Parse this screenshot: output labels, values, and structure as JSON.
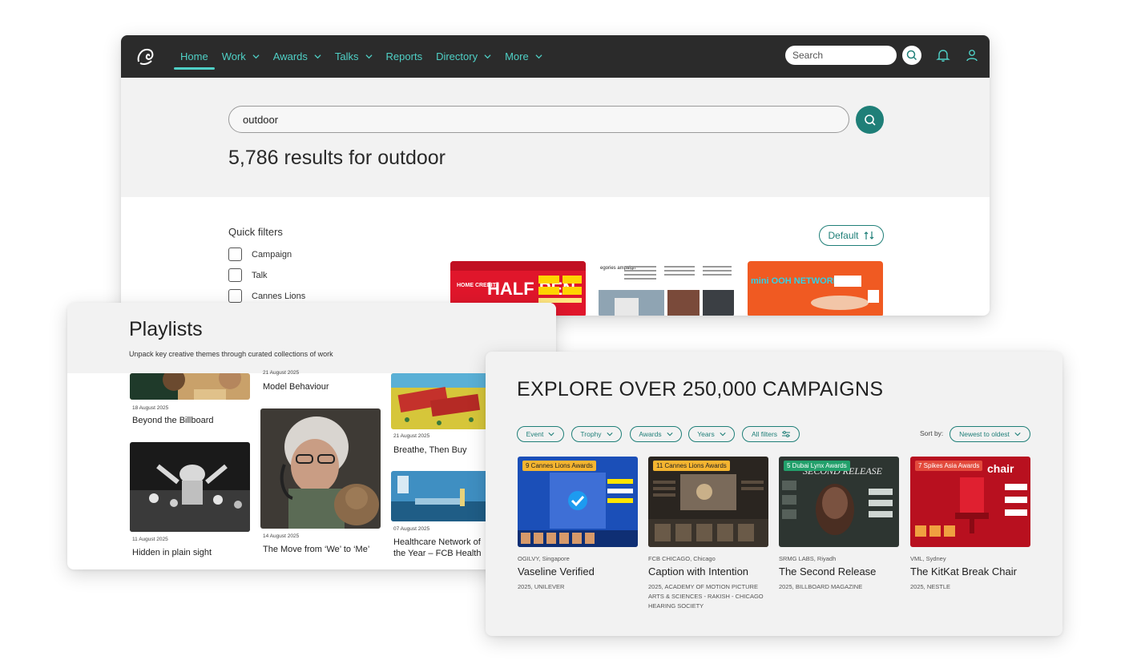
{
  "colors": {
    "accent": "#4fd0c6",
    "brand_teal": "#1f7f78",
    "nav_bg": "#2b2b2b",
    "badge": "#f5b530"
  },
  "nav": {
    "items": [
      {
        "label": "Home",
        "active": true,
        "has_dropdown": false
      },
      {
        "label": "Work",
        "has_dropdown": true
      },
      {
        "label": "Awards",
        "has_dropdown": true
      },
      {
        "label": "Talks",
        "has_dropdown": true
      },
      {
        "label": "Reports",
        "has_dropdown": false
      },
      {
        "label": "Directory",
        "has_dropdown": true
      },
      {
        "label": "More",
        "has_dropdown": true
      }
    ],
    "search_placeholder": "Search",
    "icons": [
      "lion-logo-icon",
      "search-icon",
      "bell-icon",
      "user-icon"
    ]
  },
  "search": {
    "query": "outdoor",
    "results_title": "5,786 results for outdoor",
    "sort_label": "Default"
  },
  "quick_filters": {
    "title": "Quick filters",
    "options": [
      "Campaign",
      "Talk",
      "Cannes Lions"
    ]
  },
  "playlists": {
    "title": "Playlists",
    "subtitle": "Unpack key creative themes through curated collections of work",
    "items": [
      {
        "date": "18 August 2025",
        "name": "Beyond the Billboard"
      },
      {
        "date": "21 August 2025",
        "name": "Model Behaviour"
      },
      {
        "date": "21 August 2025",
        "name": "Breathe, Then Buy"
      },
      {
        "date": "11 August 2025",
        "name": "Hidden in plain sight"
      },
      {
        "date": "14 August 2025",
        "name": "The Move from ‘We’ to ‘Me’"
      },
      {
        "date": "07 August 2025",
        "name": "Healthcare Network of the Year – FCB Health"
      }
    ]
  },
  "explore": {
    "title": "EXPLORE OVER 250,000 CAMPAIGNS",
    "filters": [
      "Event",
      "Trophy",
      "Awards",
      "Years",
      "All filters"
    ],
    "sort_by_label": "Sort by:",
    "sort_value": "Newest to oldest",
    "campaigns": [
      {
        "badge": "9 Cannes Lions Awards",
        "agency": "OGILVY, Singapore",
        "name": "Vaseline Verified",
        "meta": "2025, UNILEVER"
      },
      {
        "badge": "11 Cannes Lions Awards",
        "agency": "FCB CHICAGO, Chicago",
        "name": "Caption with Intention",
        "meta": "2025, ACADEMY OF MOTION PICTURE ARTS & SCIENCES - RAKISH - CHICAGO HEARING SOCIETY"
      },
      {
        "badge": "5 Dubai Lynx Awards",
        "agency": "SRMG LABS, Riyadh",
        "name": "The Second Release",
        "meta": "2025, BILLBOARD MAGAZINE"
      },
      {
        "badge": "7 Spikes Asia Awards",
        "agency": "VML, Sydney",
        "name": "The KitKat Break Chair",
        "meta": "2025, NESTLE"
      }
    ]
  },
  "thumb_text": {
    "halfpen": "HALF PEN",
    "home_credit": "HOME CREDIT",
    "campaign_fragment": "egories\nampaign",
    "mini_ooh": "mini OOH NETWORK",
    "second_release": "SECOND RELEASE",
    "chair": "chair"
  }
}
